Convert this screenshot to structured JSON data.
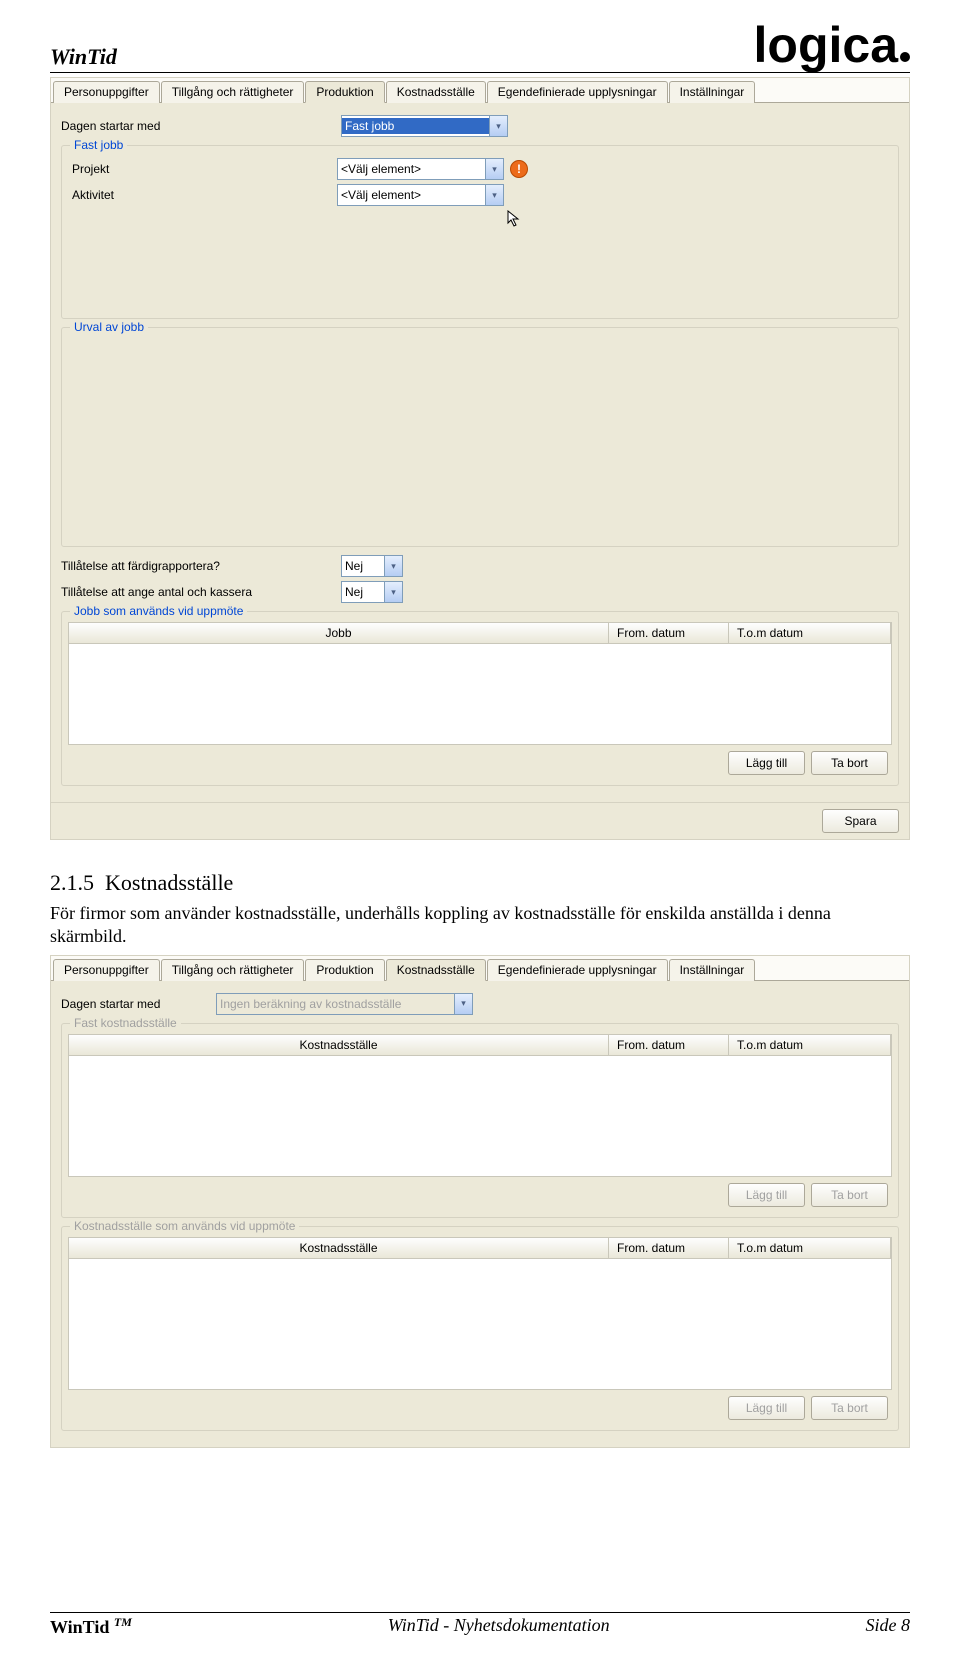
{
  "header": {
    "title": "WinTid",
    "logo": "logica"
  },
  "screenshot1": {
    "tabs": [
      "Personuppgifter",
      "Tillgång och rättigheter",
      "Produktion",
      "Kostnadsställe",
      "Egendefinierade upplysningar",
      "Inställningar"
    ],
    "active_tab": 2,
    "dagen_label": "Dagen startar med",
    "dagen_value": "Fast jobb",
    "fastjobb_legend": "Fast jobb",
    "projekt_label": "Projekt",
    "projekt_value": "<Välj element>",
    "aktivitet_label": "Aktivitet",
    "aktivitet_value": "<Välj element>",
    "urval_legend": "Urval av jobb",
    "tillat1_label": "Tillåtelse att färdigrapportera?",
    "tillat1_value": "Nej",
    "tillat2_label": "Tillåtelse att ange antal och kassera",
    "tillat2_value": "Nej",
    "jobb_legend": "Jobb som används vid uppmöte",
    "jobb_cols": [
      "Jobb",
      "From. datum",
      "T.o.m datum"
    ],
    "btn_add": "Lägg till",
    "btn_del": "Ta bort",
    "btn_save": "Spara"
  },
  "section": {
    "num": "2.1.5",
    "title": "Kostnadsställe",
    "body": "För firmor som använder kostnadsställe, underhålls koppling av kostnadsställe för enskilda anställda i denna skärmbild."
  },
  "screenshot2": {
    "tabs": [
      "Personuppgifter",
      "Tillgång och rättigheter",
      "Produktion",
      "Kostnadsställe",
      "Egendefinierade upplysningar",
      "Inställningar"
    ],
    "active_tab": 3,
    "dagen_label": "Dagen startar med",
    "dagen_value": "Ingen beräkning av kostnadsställe",
    "fast_legend": "Fast kostnadsställe",
    "cols": [
      "Kostnadsställe",
      "From. datum",
      "T.o.m datum"
    ],
    "upp_legend": "Kostnadsställe som används vid uppmöte",
    "btn_add": "Lägg till",
    "btn_del": "Ta bort"
  },
  "footer": {
    "left": "WinTid",
    "tm": "TM",
    "center": "WinTid - Nyhetsdokumentation",
    "right": "Side 8"
  }
}
